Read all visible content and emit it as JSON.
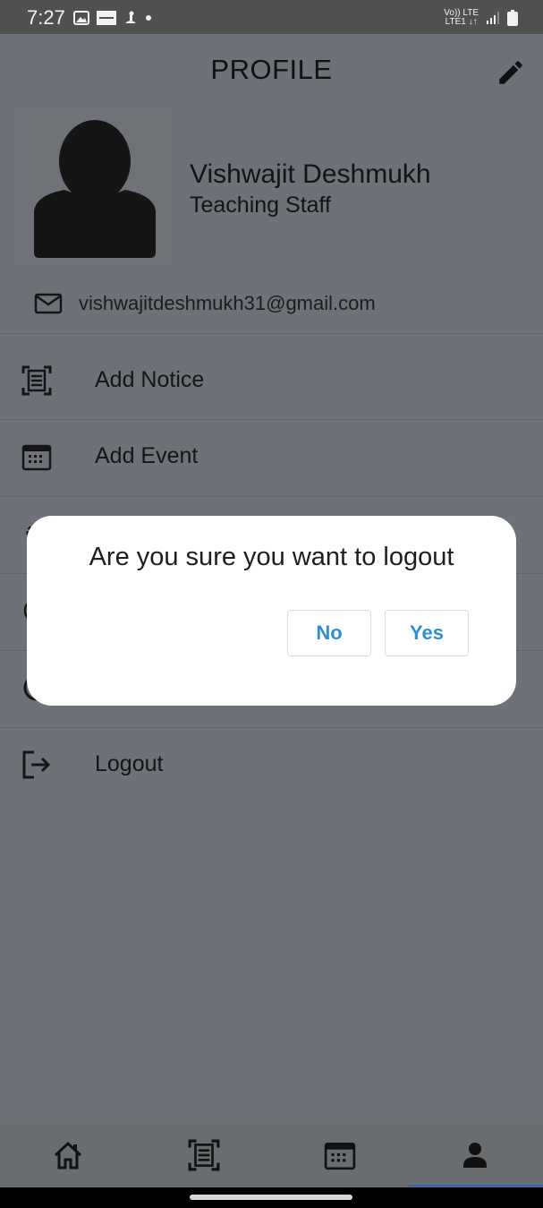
{
  "status_bar": {
    "time": "7:27",
    "network_top": "Vo)) LTE",
    "network_bottom": "LTE1 ↓↑"
  },
  "header": {
    "title": "PROFILE",
    "edit_icon": "pencil-icon"
  },
  "profile": {
    "name": "Vishwajit Deshmukh",
    "role": "Teaching Staff",
    "email": "vishwajitdeshmukh31@gmail.com"
  },
  "menu": {
    "items": [
      {
        "label": "Add Notice",
        "icon": "notice-scan-icon"
      },
      {
        "label": "Add Event",
        "icon": "calendar-icon"
      },
      {
        "label": "",
        "icon": "gear-icon"
      },
      {
        "label": "",
        "icon": "info-circle-icon"
      },
      {
        "label": "",
        "icon": "circle-icon"
      },
      {
        "label": "Logout",
        "icon": "logout-icon"
      }
    ]
  },
  "dialog": {
    "message": "Are you sure you want to logout",
    "no_label": "No",
    "yes_label": "Yes"
  },
  "bottom_nav": {
    "items": [
      "home-icon",
      "notice-scan-icon",
      "calendar-icon",
      "person-icon"
    ],
    "active": "person-icon"
  },
  "colors": {
    "accent": "#2d8fd5",
    "overlay": "#6e7278"
  }
}
